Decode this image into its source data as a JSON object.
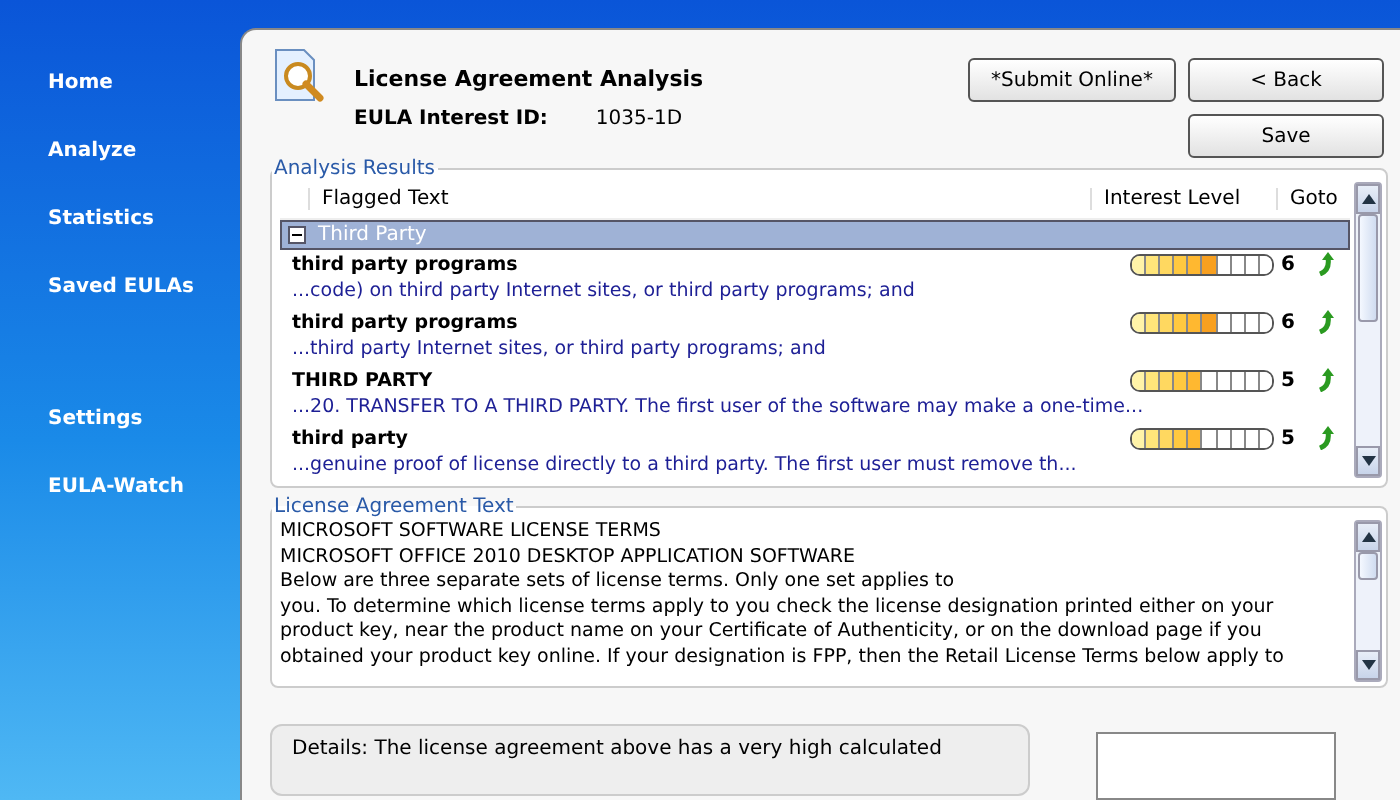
{
  "sidebar": {
    "groups": [
      {
        "items": [
          {
            "label": "Home"
          },
          {
            "label": "Analyze"
          },
          {
            "label": "Statistics"
          },
          {
            "label": "Saved EULAs"
          }
        ]
      },
      {
        "items": [
          {
            "label": "Settings"
          },
          {
            "label": "EULA-Watch"
          }
        ]
      }
    ]
  },
  "header": {
    "title": "License Agreement Analysis",
    "id_label": "EULA Interest ID:",
    "id_value": "1035-1D",
    "buttons": [
      {
        "label": "*Submit Online*"
      },
      {
        "label": "< Back"
      },
      {
        "label": "Save"
      }
    ]
  },
  "analysis": {
    "legend": "Analysis Results",
    "columns": [
      "Flagged Text",
      "Interest Level",
      "Goto"
    ],
    "group": {
      "label": "Third Party",
      "expanded": true
    },
    "rows": [
      {
        "term": "third party programs",
        "excerpt": "...code) on third party Internet sites, or third party programs; and",
        "level": 0.6,
        "score": "6"
      },
      {
        "term": "third party programs",
        "excerpt": "...third party Internet sites, or third party programs; and",
        "level": 0.6,
        "score": "6"
      },
      {
        "term": "THIRD PARTY",
        "excerpt": "...20. TRANSFER TO A THIRD PARTY. The first user of the software may make a one-time...",
        "level": 0.5,
        "score": "5"
      },
      {
        "term": "third party",
        "excerpt": "...genuine proof of license directly to a third party. The first user must remove th...",
        "level": 0.5,
        "score": "5"
      }
    ]
  },
  "license_text": {
    "legend": "License Agreement Text",
    "lines": [
      "MICROSOFT SOFTWARE LICENSE TERMS",
      "MICROSOFT OFFICE 2010 DESKTOP APPLICATION SOFTWARE",
      "Below are three separate sets of license terms. Only one set applies to",
      "you. To determine which license terms apply to you check the license designation printed either on your",
      "product key, near the product name on your Certificate of Authenticity, or on the download page if you",
      "obtained your product key online. If your designation is FPP, then the Retail License Terms below apply to"
    ]
  },
  "details": {
    "text": "Details: The license agreement above has a very high calculated"
  }
}
